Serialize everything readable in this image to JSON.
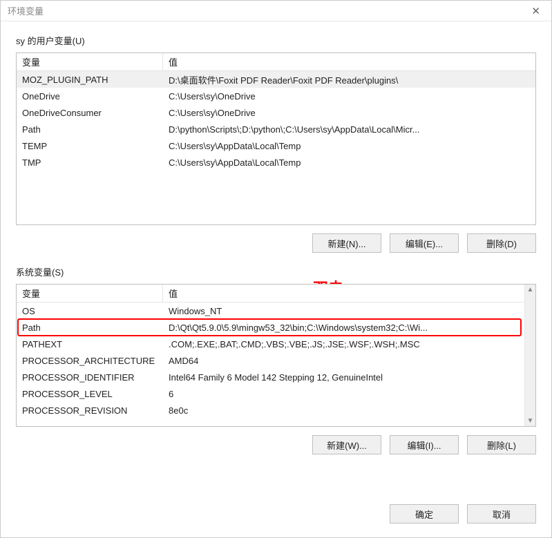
{
  "window": {
    "title": "环境变量"
  },
  "user_section": {
    "label": "sy 的用户变量(U)",
    "headers": {
      "variable": "变量",
      "value": "值"
    },
    "rows": [
      {
        "variable": "MOZ_PLUGIN_PATH",
        "value": "D:\\桌面软件\\Foxit PDF Reader\\Foxit PDF Reader\\plugins\\"
      },
      {
        "variable": "OneDrive",
        "value": "C:\\Users\\sy\\OneDrive"
      },
      {
        "variable": "OneDriveConsumer",
        "value": "C:\\Users\\sy\\OneDrive"
      },
      {
        "variable": "Path",
        "value": "D:\\python\\Scripts\\;D:\\python\\;C:\\Users\\sy\\AppData\\Local\\Micr..."
      },
      {
        "variable": "TEMP",
        "value": "C:\\Users\\sy\\AppData\\Local\\Temp"
      },
      {
        "variable": "TMP",
        "value": "C:\\Users\\sy\\AppData\\Local\\Temp"
      }
    ],
    "buttons": {
      "new": "新建(N)...",
      "edit": "编辑(E)...",
      "delete": "删除(D)"
    }
  },
  "system_section": {
    "label": "系统变量(S)",
    "headers": {
      "variable": "变量",
      "value": "值"
    },
    "rows": [
      {
        "variable": "OS",
        "value": "Windows_NT"
      },
      {
        "variable": "Path",
        "value": "D:\\Qt\\Qt5.9.0\\5.9\\mingw53_32\\bin;C:\\Windows\\system32;C:\\Wi..."
      },
      {
        "variable": "PATHEXT",
        "value": ".COM;.EXE;.BAT;.CMD;.VBS;.VBE;.JS;.JSE;.WSF;.WSH;.MSC"
      },
      {
        "variable": "PROCESSOR_ARCHITECTURE",
        "value": "AMD64"
      },
      {
        "variable": "PROCESSOR_IDENTIFIER",
        "value": "Intel64 Family 6 Model 142 Stepping 12, GenuineIntel"
      },
      {
        "variable": "PROCESSOR_LEVEL",
        "value": "6"
      },
      {
        "variable": "PROCESSOR_REVISION",
        "value": "8e0c"
      }
    ],
    "buttons": {
      "new": "新建(W)...",
      "edit": "编辑(I)...",
      "delete": "删除(L)"
    }
  },
  "annotation": {
    "text": "双击"
  },
  "footer": {
    "ok": "确定",
    "cancel": "取消"
  }
}
